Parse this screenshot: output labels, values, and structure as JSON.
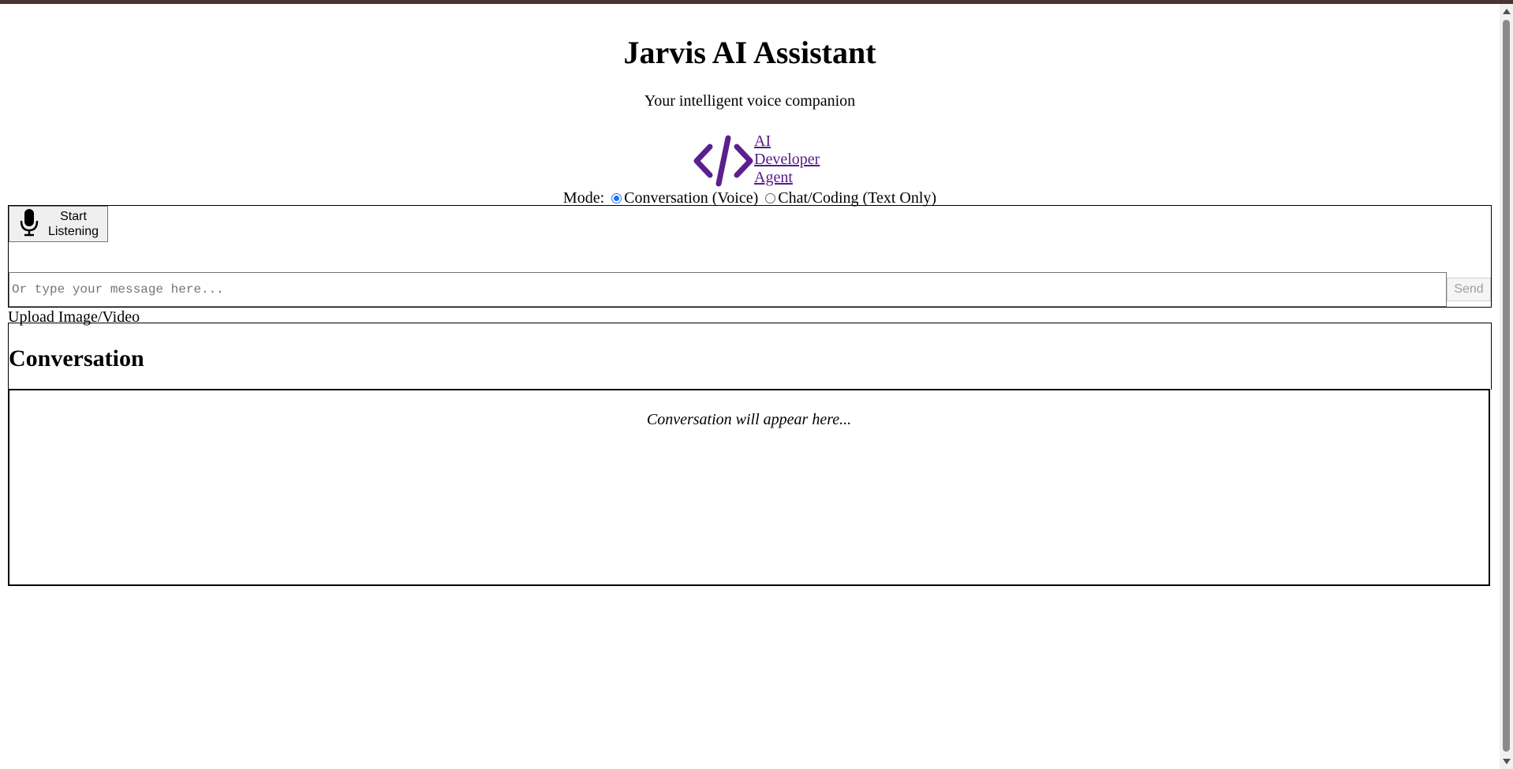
{
  "header": {
    "title": "Jarvis AI Assistant",
    "subtitle": "Your intelligent voice companion"
  },
  "brand": {
    "icon": "code-brackets-icon",
    "link_line1": "AI",
    "link_line2": "Developer",
    "link_line3": "Agent",
    "accent_color": "#5b1f8e"
  },
  "mode": {
    "label": "Mode:",
    "options": [
      {
        "label": "Conversation (Voice)",
        "selected": true
      },
      {
        "label": "Chat/Coding (Text Only)",
        "selected": false
      }
    ]
  },
  "input": {
    "listen_button_line1": "Start",
    "listen_button_line2": "Listening",
    "listen_icon": "microphone-icon",
    "message_placeholder": "Or type your message here...",
    "message_value": "",
    "send_label": "Send"
  },
  "upload": {
    "label": "Upload Image/Video"
  },
  "conversation": {
    "heading": "Conversation",
    "empty_text": "Conversation will appear here..."
  }
}
